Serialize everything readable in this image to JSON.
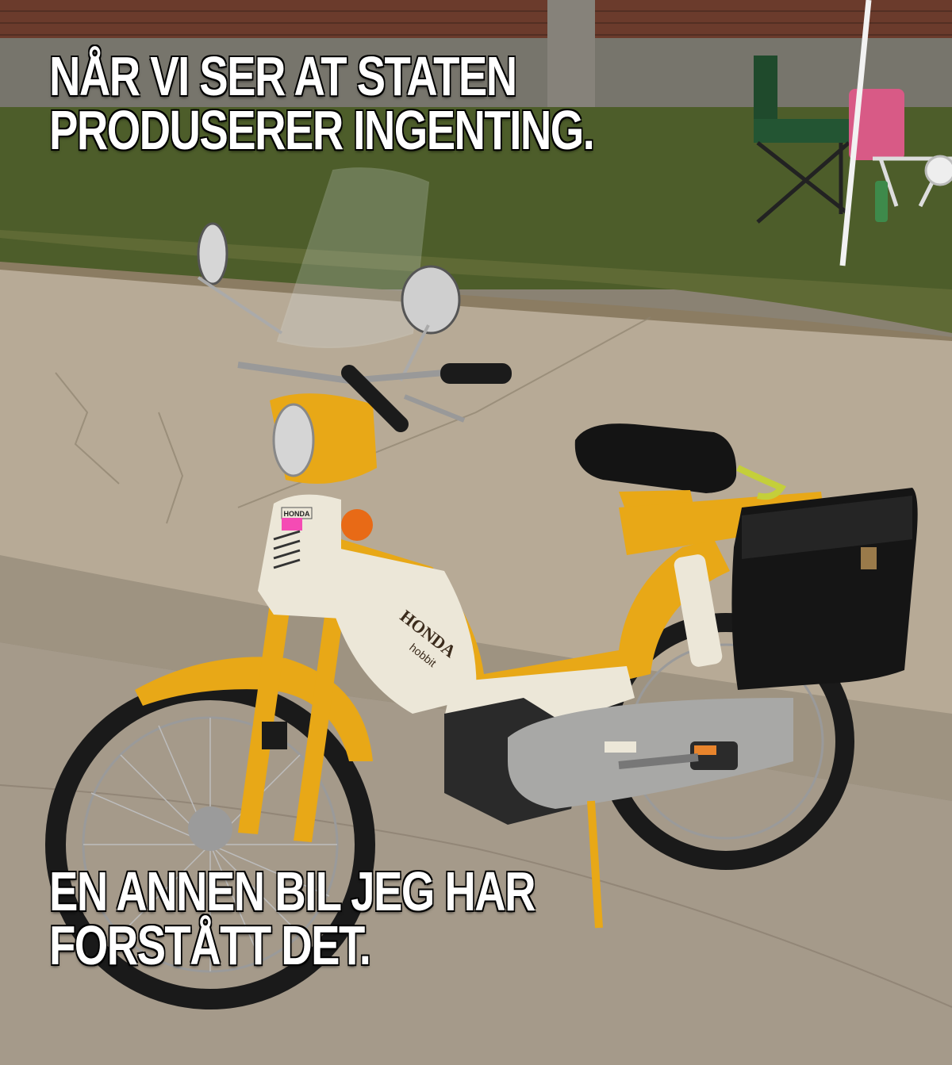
{
  "meme": {
    "top_lines": [
      "NÅR VI SER AT STATEN",
      "PRODUSERER INGENTING."
    ],
    "bottom_lines": [
      "EN ANNEN BIL JEG HAR",
      "FORSTÅTT DET."
    ]
  },
  "photo": {
    "brand_text": "HONDA",
    "model_text": "hobbit",
    "fork_badge": "HONDA"
  },
  "colors": {
    "brick": "#6b3b2c",
    "grass": "#4d5d2a",
    "pavement": "#b7aa96",
    "moped_yellow": "#e8a817",
    "moped_white": "#ece7d8",
    "bag_black": "#151515"
  }
}
